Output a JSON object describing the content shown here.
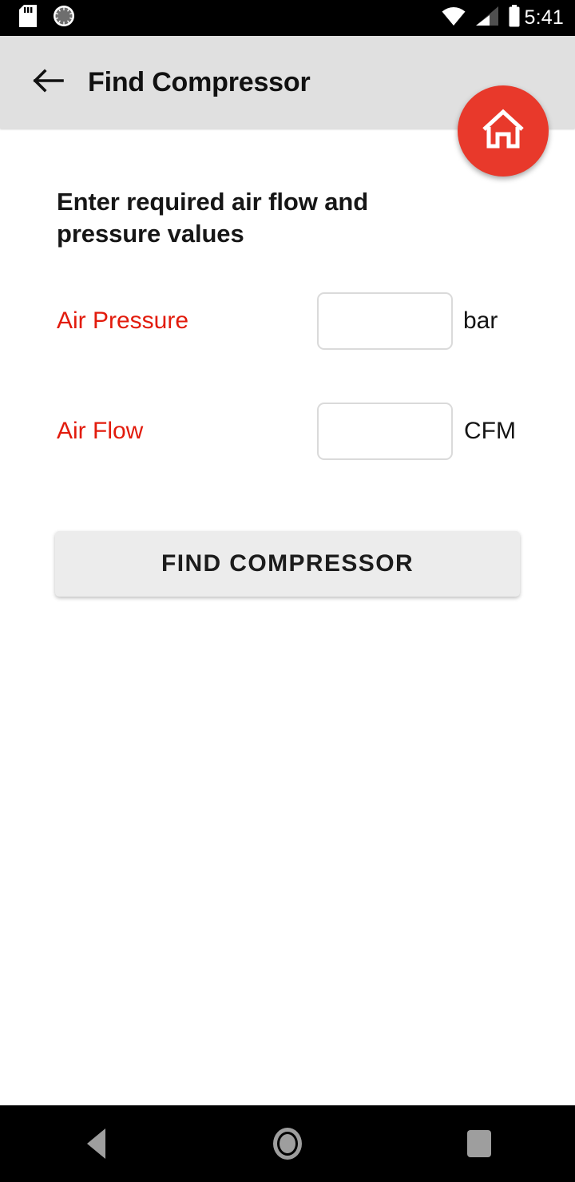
{
  "status_bar": {
    "time": "5:41",
    "left_icons": [
      "sd-card-icon",
      "sync-spinner-icon"
    ],
    "right_icons": [
      "wifi-icon",
      "cellular-signal-icon",
      "battery-icon"
    ]
  },
  "app_bar": {
    "back_icon": "arrow-left-icon",
    "title": "Find Compressor",
    "background_color": "#e0e0e0"
  },
  "fab": {
    "icon": "home-icon",
    "color": "#e8392b"
  },
  "main": {
    "heading": "Enter required air flow and pressure values",
    "fields": [
      {
        "label": "Air Pressure",
        "value": "",
        "placeholder": "",
        "unit": "bar"
      },
      {
        "label": "Air Flow",
        "value": "",
        "placeholder": "",
        "unit": "CFM"
      }
    ],
    "submit_label": "FIND COMPRESSOR",
    "label_color": "#e21b0c"
  },
  "nav_bar": {
    "back_label": "back-button",
    "home_label": "home-button",
    "recents_label": "recents-button"
  }
}
